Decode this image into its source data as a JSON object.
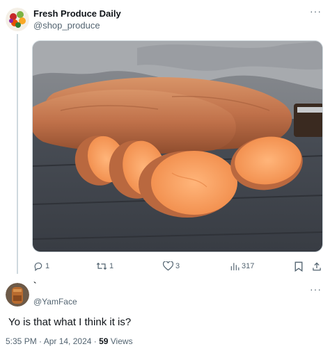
{
  "post": {
    "author_name": "Fresh Produce Daily",
    "author_handle": "@shop_produce",
    "more_label": "···",
    "media_alt": "Sweet potatoes on a wooden table",
    "actions": {
      "replies": "1",
      "reposts": "1",
      "likes": "3",
      "views": "317"
    }
  },
  "reply": {
    "author_name": "`",
    "author_handle": "@YamFace",
    "more_label": "···",
    "text": "Yo is that what I think it is?",
    "time": "5:35 PM · Apr 14, 2024 · ",
    "views_count": "59",
    "views_label": " Views"
  },
  "colors": {
    "text_primary": "#0f1419",
    "text_secondary": "#536471",
    "thread_line": "#cfd9de",
    "potato_skin": "#c0714a",
    "potato_flesh": "#f59a5c"
  },
  "icons": [
    "reply-icon",
    "repost-icon",
    "like-icon",
    "views-icon",
    "bookmark-icon",
    "share-icon"
  ]
}
